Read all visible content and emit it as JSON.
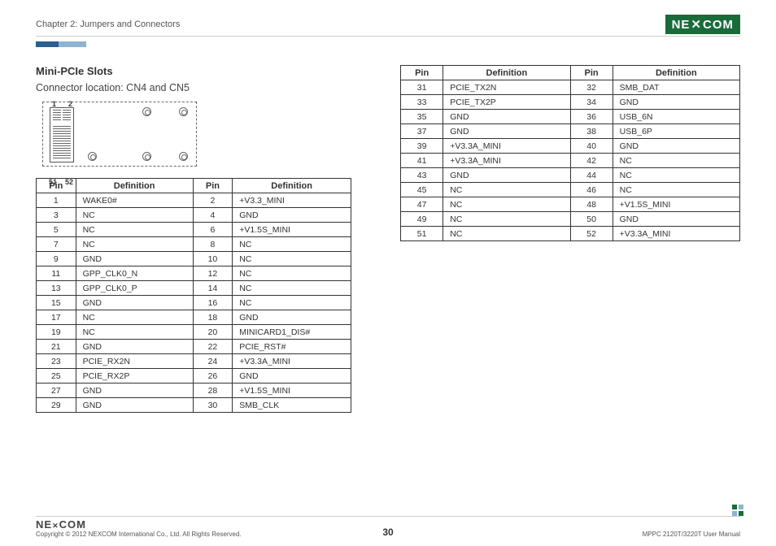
{
  "header": {
    "chapter": "Chapter 2: Jumpers and Connectors",
    "logo": "NEXCOM"
  },
  "section": {
    "title": "Mini-PCIe Slots",
    "subtitle": "Connector location: CN4 and CN5"
  },
  "diagram_labels": {
    "tl": "1",
    "tr": "2",
    "bl": "51",
    "br": "52"
  },
  "table_headers": {
    "pin": "Pin",
    "def": "Definition"
  },
  "table_left": [
    {
      "p1": "1",
      "d1": "WAKE0#",
      "p2": "2",
      "d2": "+V3.3_MINI"
    },
    {
      "p1": "3",
      "d1": "NC",
      "p2": "4",
      "d2": "GND"
    },
    {
      "p1": "5",
      "d1": "NC",
      "p2": "6",
      "d2": "+V1.5S_MINI"
    },
    {
      "p1": "7",
      "d1": "NC",
      "p2": "8",
      "d2": "NC"
    },
    {
      "p1": "9",
      "d1": "GND",
      "p2": "10",
      "d2": "NC"
    },
    {
      "p1": "11",
      "d1": "GPP_CLK0_N",
      "p2": "12",
      "d2": "NC"
    },
    {
      "p1": "13",
      "d1": "GPP_CLK0_P",
      "p2": "14",
      "d2": "NC"
    },
    {
      "p1": "15",
      "d1": "GND",
      "p2": "16",
      "d2": "NC"
    },
    {
      "p1": "17",
      "d1": "NC",
      "p2": "18",
      "d2": "GND"
    },
    {
      "p1": "19",
      "d1": "NC",
      "p2": "20",
      "d2": "MINICARD1_DIS#"
    },
    {
      "p1": "21",
      "d1": "GND",
      "p2": "22",
      "d2": "PCIE_RST#"
    },
    {
      "p1": "23",
      "d1": "PCIE_RX2N",
      "p2": "24",
      "d2": "+V3.3A_MINI"
    },
    {
      "p1": "25",
      "d1": "PCIE_RX2P",
      "p2": "26",
      "d2": "GND"
    },
    {
      "p1": "27",
      "d1": "GND",
      "p2": "28",
      "d2": "+V1.5S_MINI"
    },
    {
      "p1": "29",
      "d1": "GND",
      "p2": "30",
      "d2": "SMB_CLK"
    }
  ],
  "table_right": [
    {
      "p1": "31",
      "d1": "PCIE_TX2N",
      "p2": "32",
      "d2": "SMB_DAT"
    },
    {
      "p1": "33",
      "d1": "PCIE_TX2P",
      "p2": "34",
      "d2": "GND"
    },
    {
      "p1": "35",
      "d1": "GND",
      "p2": "36",
      "d2": "USB_6N"
    },
    {
      "p1": "37",
      "d1": "GND",
      "p2": "38",
      "d2": "USB_6P"
    },
    {
      "p1": "39",
      "d1": "+V3.3A_MINI",
      "p2": "40",
      "d2": "GND"
    },
    {
      "p1": "41",
      "d1": "+V3.3A_MINI",
      "p2": "42",
      "d2": "NC"
    },
    {
      "p1": "43",
      "d1": "GND",
      "p2": "44",
      "d2": "NC"
    },
    {
      "p1": "45",
      "d1": "NC",
      "p2": "46",
      "d2": "NC"
    },
    {
      "p1": "47",
      "d1": "NC",
      "p2": "48",
      "d2": "+V1.5S_MINI"
    },
    {
      "p1": "49",
      "d1": "NC",
      "p2": "50",
      "d2": "GND"
    },
    {
      "p1": "51",
      "d1": "NC",
      "p2": "52",
      "d2": "+V3.3A_MINI"
    }
  ],
  "footer": {
    "logo": "NE COM",
    "copyright": "Copyright © 2012 NEXCOM International Co., Ltd. All Rights Reserved.",
    "page": "30",
    "manual": "MPPC 2120T/3220T User Manual"
  }
}
